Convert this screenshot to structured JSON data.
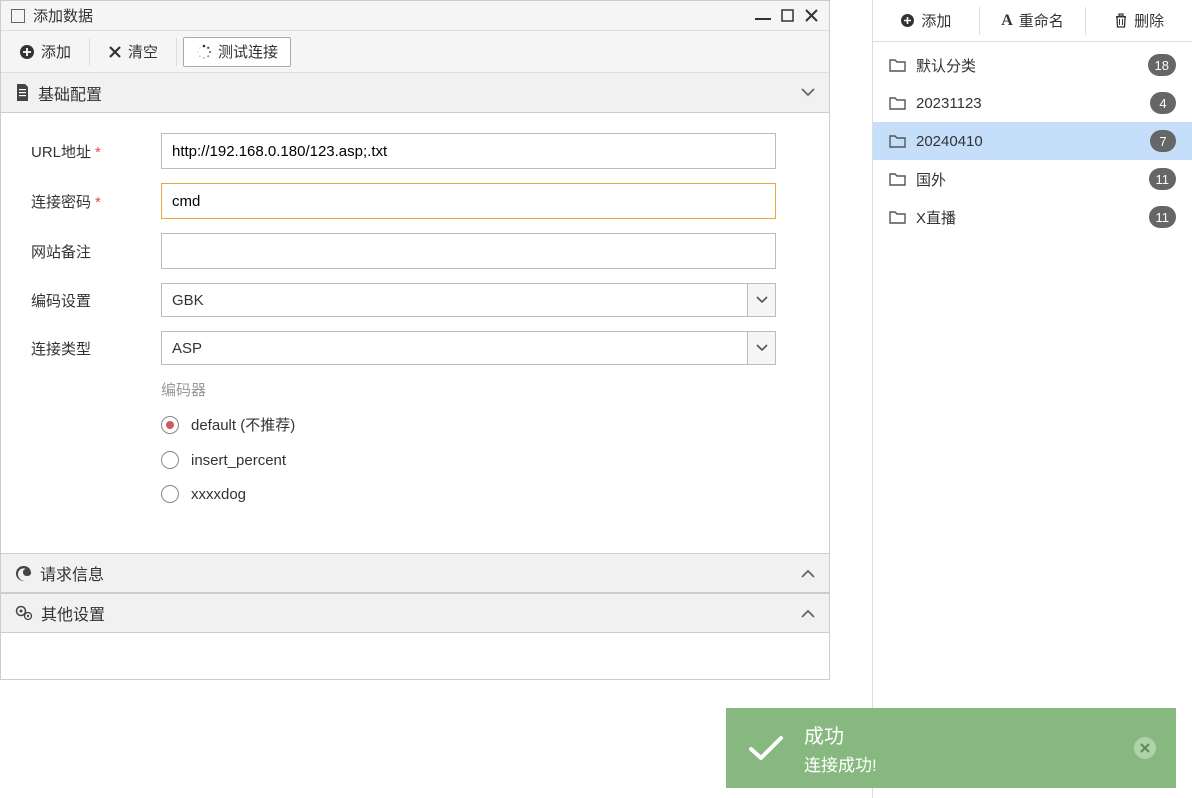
{
  "dialog": {
    "title": "添加数据",
    "toolbar": {
      "add": "添加",
      "clear": "清空",
      "test": "测试连接"
    },
    "accordion": {
      "basic": "基础配置",
      "request": "请求信息",
      "other": "其他设置"
    },
    "form": {
      "url_label": "URL地址",
      "url_value": "http://192.168.0.180/123.asp;.txt",
      "password_label": "连接密码",
      "password_value": "cmd",
      "note_label": "网站备注",
      "note_value": "",
      "encoding_label": "编码设置",
      "encoding_value": "GBK",
      "conntype_label": "连接类型",
      "conntype_value": "ASP",
      "encoder_label": "编码器",
      "encoder_options": [
        {
          "label": "default (不推荐)",
          "selected": true
        },
        {
          "label": "insert_percent",
          "selected": false
        },
        {
          "label": "xxxxdog",
          "selected": false
        }
      ]
    }
  },
  "sidebar": {
    "toolbar": {
      "add": "添加",
      "rename": "重命名",
      "delete": "删除"
    },
    "folders": [
      {
        "name": "默认分类",
        "count": "18",
        "selected": false
      },
      {
        "name": "20231123",
        "count": "4",
        "selected": false
      },
      {
        "name": "20240410",
        "count": "7",
        "selected": true
      },
      {
        "name": "国外",
        "count": "11",
        "selected": false
      },
      {
        "name": "X直播",
        "count": "11",
        "selected": false
      }
    ]
  },
  "toast": {
    "title": "成功",
    "message": "连接成功!"
  }
}
